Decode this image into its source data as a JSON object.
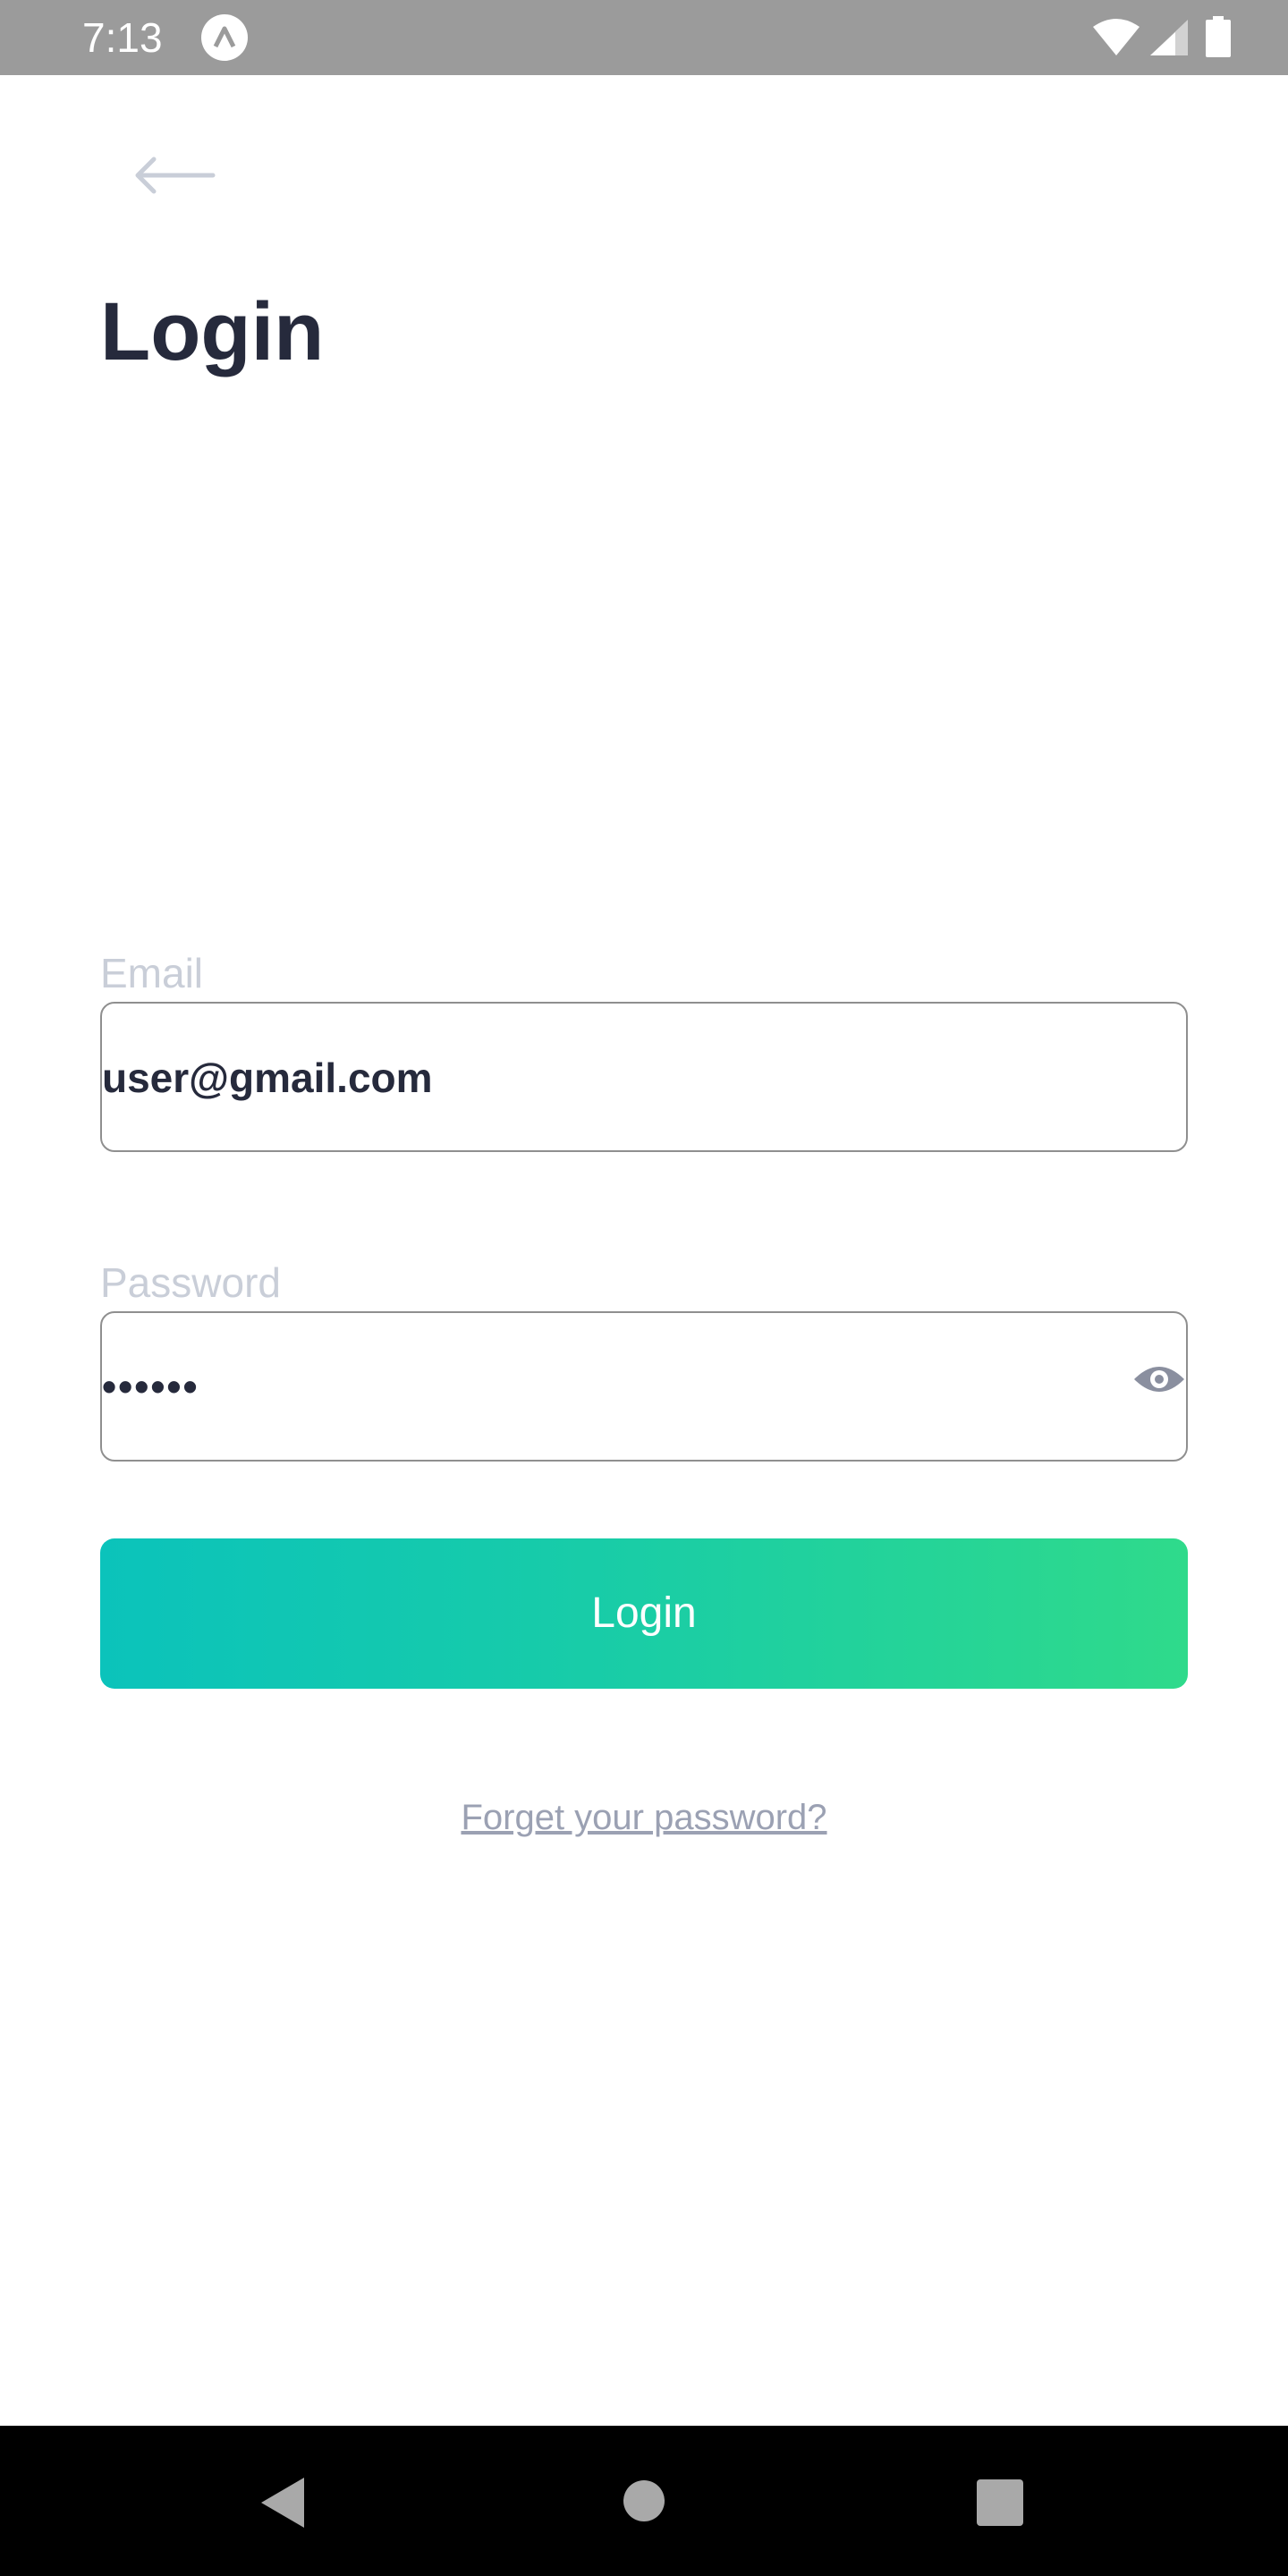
{
  "status_bar": {
    "time": "7:13",
    "app_icon": "a-app-icon",
    "icons": [
      "wifi-icon",
      "signal-icon",
      "battery-icon"
    ]
  },
  "header": {
    "back_icon": "arrow-left-icon",
    "title": "Login"
  },
  "form": {
    "email": {
      "label": "Email",
      "value": "user@gmail.com"
    },
    "password": {
      "label": "Password",
      "value": "••••••",
      "toggle_icon": "eye-icon"
    },
    "submit_label": "Login",
    "forgot_label": "Forget your password?"
  },
  "nav_bar": {
    "icons": [
      "nav-back-icon",
      "nav-home-icon",
      "nav-recents-icon"
    ]
  },
  "colors": {
    "status_bar": "#9b9b9b",
    "title": "#262a3c",
    "label": "#c9ced8",
    "field_border": "#8f8f8f",
    "button_gradient_start": "#0bc3bb",
    "button_gradient_end": "#2fda8b",
    "link": "#9ba1b3",
    "nav_bar": "#000000"
  }
}
